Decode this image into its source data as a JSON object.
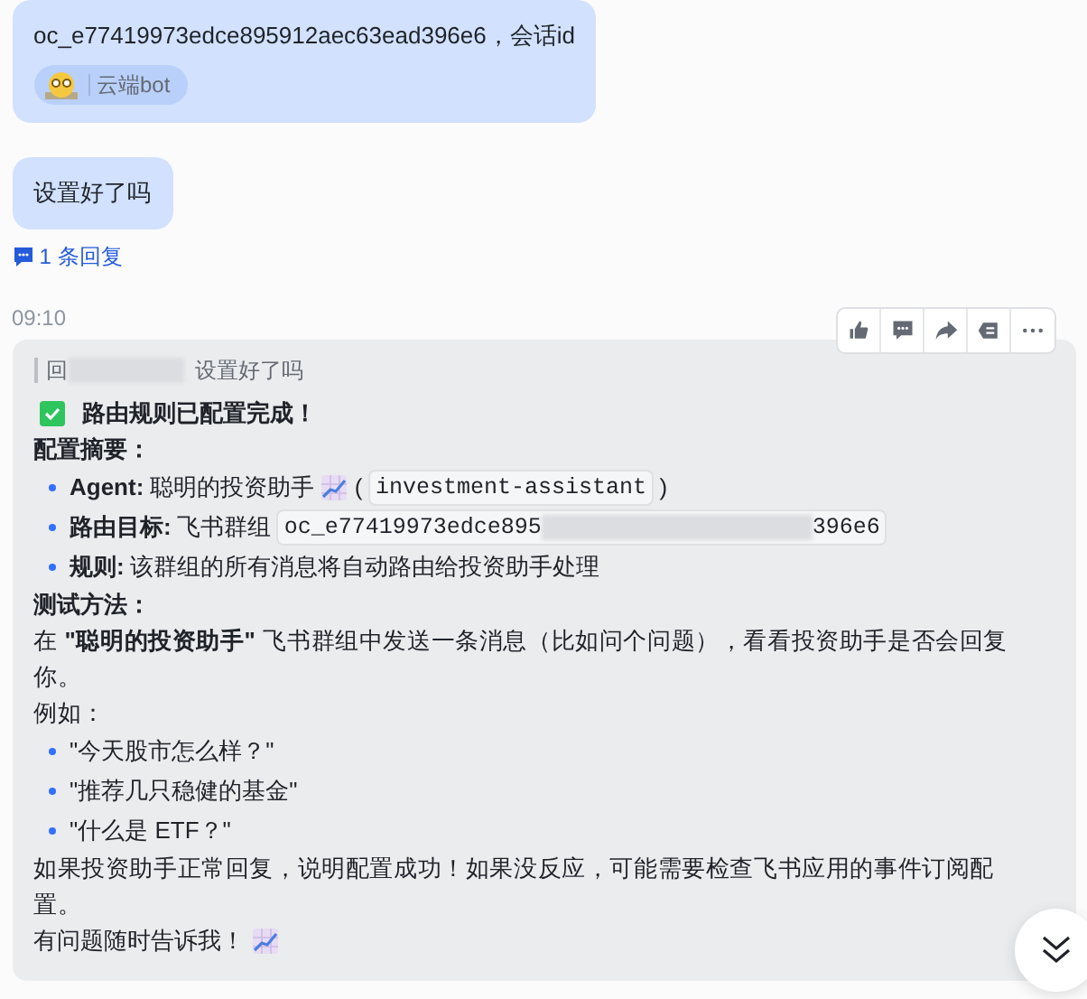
{
  "messages": [
    {
      "text": "oc_e77419973edce895912aec63ead396e6，会话id",
      "tag": "云端bot"
    },
    {
      "text": "设置好了吗"
    }
  ],
  "reply_link": "1 条回复",
  "bot_message": {
    "time": "09:10",
    "actions": [
      {
        "kind": "like"
      },
      {
        "kind": "comment"
      },
      {
        "kind": "forward"
      },
      {
        "kind": "quote"
      },
      {
        "kind": "more"
      }
    ],
    "quote": {
      "prefix": "回",
      "text": "设置好了吗"
    },
    "blocks": [
      {
        "kind": "check_heading",
        "text": "路由规则已配置完成！"
      },
      {
        "kind": "bold_line",
        "text": "配置摘要："
      },
      {
        "kind": "bullets",
        "items": [
          {
            "segments": [
              {
                "kind": "bold",
                "text": "Agent:"
              },
              {
                "kind": "text",
                "text": "聪明的投资助手"
              },
              {
                "kind": "chart_icon"
              },
              {
                "kind": "text",
                "text": "("
              },
              {
                "kind": "code",
                "parts": [
                  "investment-assistant"
                ]
              },
              {
                "kind": "text",
                "text": ")"
              }
            ]
          },
          {
            "segments": [
              {
                "kind": "bold",
                "text": "路由目标:"
              },
              {
                "kind": "text",
                "text": "飞书群组"
              },
              {
                "kind": "code",
                "parts": [
                  "oc_e77419973edce895",
                  "396e6"
                ]
              }
            ]
          },
          {
            "segments": [
              {
                "kind": "bold",
                "text": "规则:"
              },
              {
                "kind": "text",
                "text": "该群组的所有消息将自动路由给投资助手处理"
              }
            ]
          }
        ]
      },
      {
        "kind": "bold_line",
        "text": "测试方法："
      },
      {
        "kind": "paragraph",
        "text": "在 **\"聪明的投资助手\"** 飞书群组中发送一条消息（比如问个问题），看看投资助手是否会回复你。"
      },
      {
        "kind": "paragraph",
        "text": "例如："
      },
      {
        "kind": "bullets",
        "items": [
          {
            "segments": [
              {
                "kind": "text",
                "text": "\"今天股市怎么样？\""
              }
            ]
          },
          {
            "segments": [
              {
                "kind": "text",
                "text": "\"推荐几只稳健的基金\""
              }
            ]
          },
          {
            "segments": [
              {
                "kind": "text",
                "text": "\"什么是 ETF？\""
              }
            ]
          }
        ]
      },
      {
        "kind": "paragraph",
        "text": "如果投资助手正常回复，说明配置成功！如果没反应，可能需要检查飞书应用的事件订阅配置。"
      },
      {
        "kind": "line",
        "segments": [
          {
            "kind": "text",
            "text": "有问题随时告诉我！"
          },
          {
            "kind": "chart_icon"
          }
        ]
      }
    ]
  }
}
